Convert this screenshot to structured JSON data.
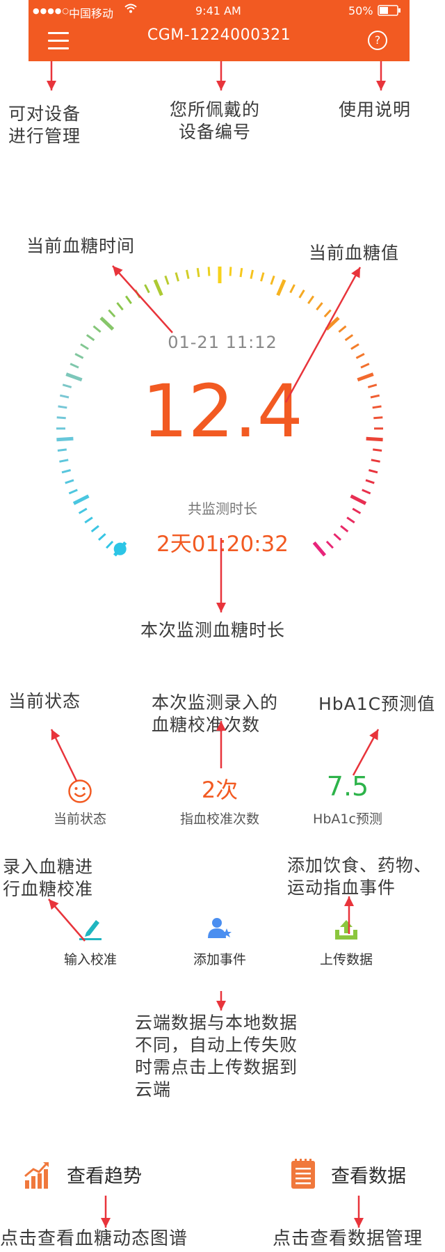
{
  "status_bar": {
    "signal": "●●●●○",
    "carrier": "中国移动",
    "wifi_icon": "wifi-icon",
    "time": "9:41 AM",
    "battery": "50%"
  },
  "header": {
    "title": "CGM-1224000321",
    "menu_icon": "hamburger-menu-icon",
    "help_icon": "help-icon",
    "help_symbol": "?"
  },
  "annotations": {
    "menu": "可对设备\n进行管理",
    "device_id": "您所佩戴的\n设备编号",
    "help": "使用说明",
    "glucose_time": "当前血糖时间",
    "glucose_value": "当前血糖值",
    "duration": "本次监测血糖时长",
    "status": "当前状态",
    "calibration_count": "本次监测录入的\n血糖校准次数",
    "hba1c": "HbA1C预测值",
    "input_calibration": "录入血糖进\n行血糖校准",
    "add_event": "添加饮食、药物、\n运动指血事件",
    "upload": "云端数据与本地数据\n不同，自动上传失败\n时需点击上传数据到\n云端",
    "trend": "点击查看血糖动态图谱",
    "data": "点击查看数据管理"
  },
  "gauge": {
    "time": "01-21  11:12",
    "value": "12.4",
    "duration_label": "共监测时长",
    "duration": "2天01:20:32"
  },
  "stats": {
    "status_icon": "smiley-face-icon",
    "status_label": "当前状态",
    "calibration_value": "2次",
    "calibration_label": "指血校准次数",
    "hba1c_value": "7.5",
    "hba1c_label": "HbA1c预测"
  },
  "actions": {
    "input_calibration": {
      "label": "输入校准",
      "icon": "pencil-icon"
    },
    "add_event": {
      "label": "添加事件",
      "icon": "user-star-icon"
    },
    "upload": {
      "label": "上传数据",
      "icon": "upload-icon"
    }
  },
  "bottom": {
    "trend": {
      "label": "查看趋势",
      "icon": "trend-chart-icon"
    },
    "data": {
      "label": "查看数据",
      "icon": "notepad-icon"
    }
  },
  "colors": {
    "accent": "#f25a22",
    "arrow": "#e8343b",
    "hba1c": "#2db34a",
    "icon_teal": "#1fb5c0",
    "icon_blue": "#4a8ef0",
    "icon_green": "#8bc63e"
  }
}
